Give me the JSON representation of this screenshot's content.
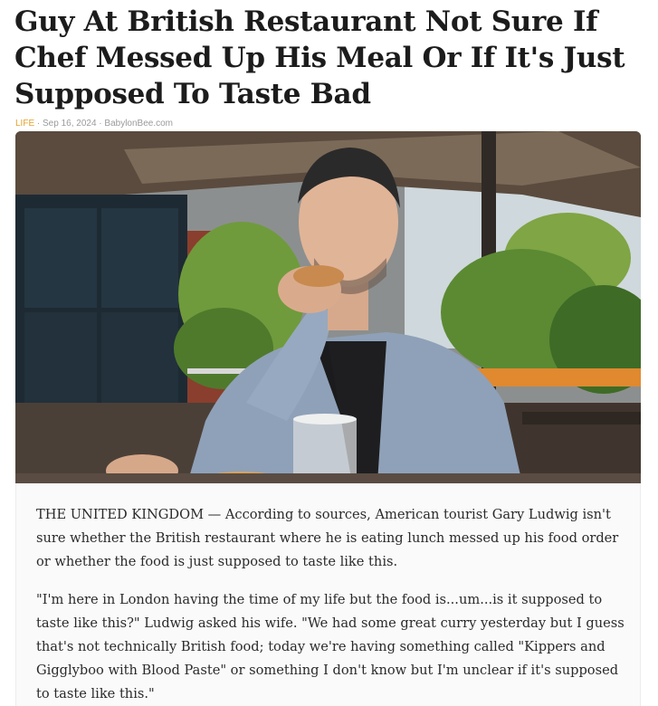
{
  "article": {
    "headline": "Guy At British Restaurant Not Sure If Chef Messed Up His Meal Or If It's Just Supposed To Taste Bad",
    "category": "LIFE",
    "separator1": " · ",
    "date": "Sep 16, 2024",
    "separator2": " · ",
    "source": "BabylonBee.com",
    "paragraphs": [
      "THE UNITED KINGDOM — According to sources, American tourist Gary Ludwig isn't sure whether the British restaurant where he is eating lunch messed up his food order or whether the food is just supposed to taste like this.",
      "\"I'm here in London having the time of my life but the food is...um...is it supposed to taste like this?\" Ludwig asked his wife. \"We had some great curry yesterday but I guess that's not technically British food; today we're having something called \"Kippers and Gigglyboo with Blood Paste\" or something I don't know but I'm unclear if it's supposed to taste like this.\""
    ]
  },
  "colors": {
    "category": "#e5a02a",
    "meta": "#9a9a9a",
    "headline": "#1c1c1c"
  }
}
